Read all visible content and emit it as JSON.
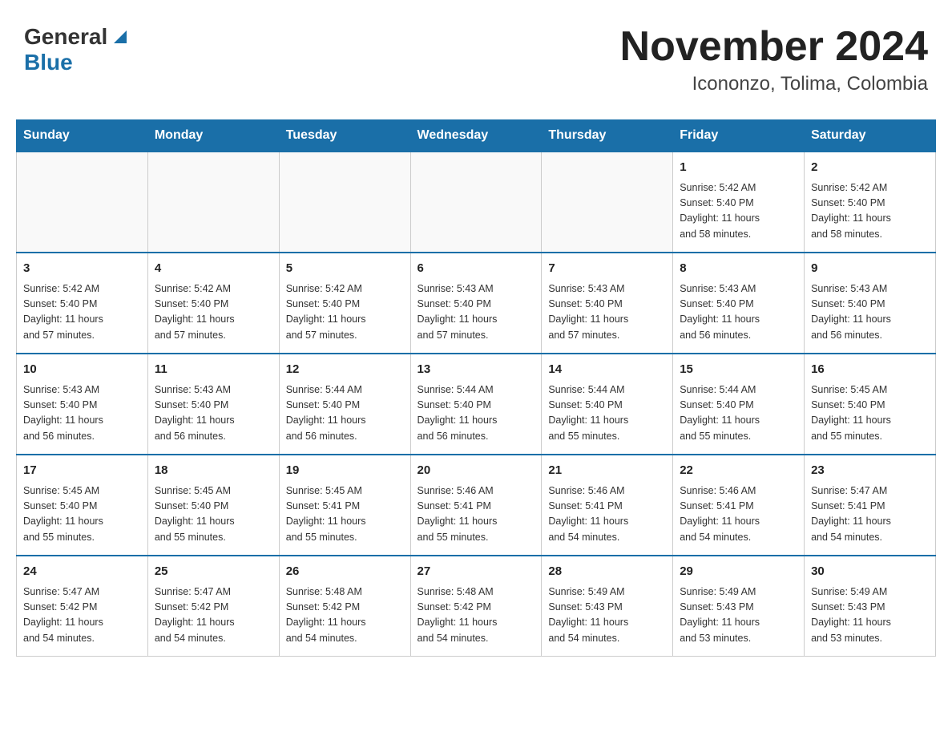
{
  "header": {
    "logo": {
      "general": "General",
      "blue": "Blue",
      "alt": "GeneralBlue logo"
    },
    "title": "November 2024",
    "subtitle": "Icononzo, Tolima, Colombia"
  },
  "weekdays": [
    "Sunday",
    "Monday",
    "Tuesday",
    "Wednesday",
    "Thursday",
    "Friday",
    "Saturday"
  ],
  "weeks": [
    [
      {
        "day": "",
        "info": ""
      },
      {
        "day": "",
        "info": ""
      },
      {
        "day": "",
        "info": ""
      },
      {
        "day": "",
        "info": ""
      },
      {
        "day": "",
        "info": ""
      },
      {
        "day": "1",
        "info": "Sunrise: 5:42 AM\nSunset: 5:40 PM\nDaylight: 11 hours\nand 58 minutes."
      },
      {
        "day": "2",
        "info": "Sunrise: 5:42 AM\nSunset: 5:40 PM\nDaylight: 11 hours\nand 58 minutes."
      }
    ],
    [
      {
        "day": "3",
        "info": "Sunrise: 5:42 AM\nSunset: 5:40 PM\nDaylight: 11 hours\nand 57 minutes."
      },
      {
        "day": "4",
        "info": "Sunrise: 5:42 AM\nSunset: 5:40 PM\nDaylight: 11 hours\nand 57 minutes."
      },
      {
        "day": "5",
        "info": "Sunrise: 5:42 AM\nSunset: 5:40 PM\nDaylight: 11 hours\nand 57 minutes."
      },
      {
        "day": "6",
        "info": "Sunrise: 5:43 AM\nSunset: 5:40 PM\nDaylight: 11 hours\nand 57 minutes."
      },
      {
        "day": "7",
        "info": "Sunrise: 5:43 AM\nSunset: 5:40 PM\nDaylight: 11 hours\nand 57 minutes."
      },
      {
        "day": "8",
        "info": "Sunrise: 5:43 AM\nSunset: 5:40 PM\nDaylight: 11 hours\nand 56 minutes."
      },
      {
        "day": "9",
        "info": "Sunrise: 5:43 AM\nSunset: 5:40 PM\nDaylight: 11 hours\nand 56 minutes."
      }
    ],
    [
      {
        "day": "10",
        "info": "Sunrise: 5:43 AM\nSunset: 5:40 PM\nDaylight: 11 hours\nand 56 minutes."
      },
      {
        "day": "11",
        "info": "Sunrise: 5:43 AM\nSunset: 5:40 PM\nDaylight: 11 hours\nand 56 minutes."
      },
      {
        "day": "12",
        "info": "Sunrise: 5:44 AM\nSunset: 5:40 PM\nDaylight: 11 hours\nand 56 minutes."
      },
      {
        "day": "13",
        "info": "Sunrise: 5:44 AM\nSunset: 5:40 PM\nDaylight: 11 hours\nand 56 minutes."
      },
      {
        "day": "14",
        "info": "Sunrise: 5:44 AM\nSunset: 5:40 PM\nDaylight: 11 hours\nand 55 minutes."
      },
      {
        "day": "15",
        "info": "Sunrise: 5:44 AM\nSunset: 5:40 PM\nDaylight: 11 hours\nand 55 minutes."
      },
      {
        "day": "16",
        "info": "Sunrise: 5:45 AM\nSunset: 5:40 PM\nDaylight: 11 hours\nand 55 minutes."
      }
    ],
    [
      {
        "day": "17",
        "info": "Sunrise: 5:45 AM\nSunset: 5:40 PM\nDaylight: 11 hours\nand 55 minutes."
      },
      {
        "day": "18",
        "info": "Sunrise: 5:45 AM\nSunset: 5:40 PM\nDaylight: 11 hours\nand 55 minutes."
      },
      {
        "day": "19",
        "info": "Sunrise: 5:45 AM\nSunset: 5:41 PM\nDaylight: 11 hours\nand 55 minutes."
      },
      {
        "day": "20",
        "info": "Sunrise: 5:46 AM\nSunset: 5:41 PM\nDaylight: 11 hours\nand 55 minutes."
      },
      {
        "day": "21",
        "info": "Sunrise: 5:46 AM\nSunset: 5:41 PM\nDaylight: 11 hours\nand 54 minutes."
      },
      {
        "day": "22",
        "info": "Sunrise: 5:46 AM\nSunset: 5:41 PM\nDaylight: 11 hours\nand 54 minutes."
      },
      {
        "day": "23",
        "info": "Sunrise: 5:47 AM\nSunset: 5:41 PM\nDaylight: 11 hours\nand 54 minutes."
      }
    ],
    [
      {
        "day": "24",
        "info": "Sunrise: 5:47 AM\nSunset: 5:42 PM\nDaylight: 11 hours\nand 54 minutes."
      },
      {
        "day": "25",
        "info": "Sunrise: 5:47 AM\nSunset: 5:42 PM\nDaylight: 11 hours\nand 54 minutes."
      },
      {
        "day": "26",
        "info": "Sunrise: 5:48 AM\nSunset: 5:42 PM\nDaylight: 11 hours\nand 54 minutes."
      },
      {
        "day": "27",
        "info": "Sunrise: 5:48 AM\nSunset: 5:42 PM\nDaylight: 11 hours\nand 54 minutes."
      },
      {
        "day": "28",
        "info": "Sunrise: 5:49 AM\nSunset: 5:43 PM\nDaylight: 11 hours\nand 54 minutes."
      },
      {
        "day": "29",
        "info": "Sunrise: 5:49 AM\nSunset: 5:43 PM\nDaylight: 11 hours\nand 53 minutes."
      },
      {
        "day": "30",
        "info": "Sunrise: 5:49 AM\nSunset: 5:43 PM\nDaylight: 11 hours\nand 53 minutes."
      }
    ]
  ]
}
